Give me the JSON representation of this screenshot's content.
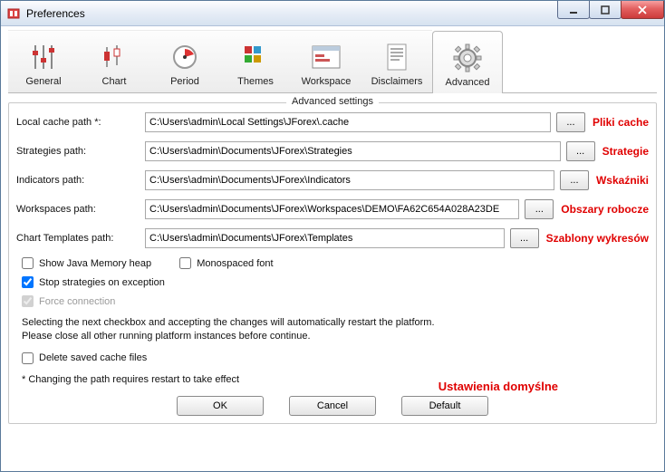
{
  "window": {
    "title": "Preferences"
  },
  "tabs": {
    "general": "General",
    "chart": "Chart",
    "period": "Period",
    "themes": "Themes",
    "workspace": "Workspace",
    "disclaimers": "Disclaimers",
    "advanced": "Advanced"
  },
  "legend": "Advanced settings",
  "fields": {
    "cache": {
      "label": "Local cache path *:",
      "value": "C:\\Users\\admin\\Local Settings\\JForex\\.cache",
      "annot": "Pliki cache"
    },
    "strategies": {
      "label": "Strategies path:",
      "value": "C:\\Users\\admin\\Documents\\JForex\\Strategies",
      "annot": "Strategie"
    },
    "indicators": {
      "label": "Indicators path:",
      "value": "C:\\Users\\admin\\Documents\\JForex\\Indicators",
      "annot": "Wskaźniki"
    },
    "workspaces": {
      "label": "Workspaces path:",
      "value": "C:\\Users\\admin\\Documents\\JForex\\Workspaces\\DEMO\\FA62C654A028A23DE",
      "annot": "Obszary robocze"
    },
    "templates": {
      "label": "Chart Templates path:",
      "value": "C:\\Users\\admin\\Documents\\JForex\\Templates",
      "annot": "Szablony wykresów"
    }
  },
  "browse_label": "...",
  "checks": {
    "heap": "Show Java Memory heap",
    "mono": "Monospaced font",
    "stop": "Stop strategies on exception",
    "force": "Force connection",
    "delete": "Delete saved cache files"
  },
  "notes": {
    "line1": "Selecting the next checkbox and accepting the changes will automatically restart the platform.",
    "line2": "Please close all other running platform instances before continue.",
    "star": "* Changing the path requires restart to take effect"
  },
  "buttons": {
    "ok": "OK",
    "cancel": "Cancel",
    "default": "Default"
  },
  "default_annot": "Ustawienia domyślne"
}
